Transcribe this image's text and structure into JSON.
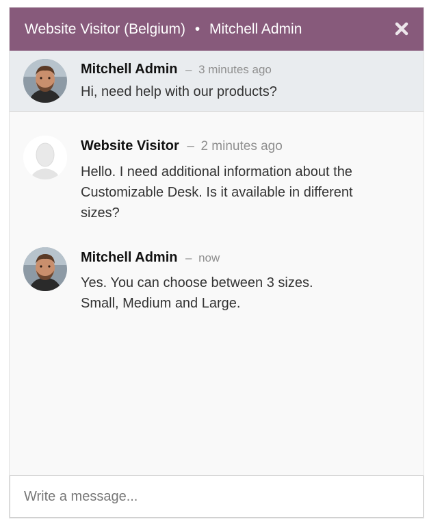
{
  "header": {
    "visitor": "Website Visitor (Belgium)",
    "separator": "•",
    "operator": "Mitchell Admin",
    "bg_color": "#875a7b",
    "close_icon": "close-icon"
  },
  "messages": [
    {
      "author": "Mitchell Admin",
      "separator": "–",
      "time": "3 minutes ago",
      "body": "Hi, need help with our products?",
      "avatar": "admin-avatar"
    },
    {
      "author": "Website Visitor",
      "separator": "–",
      "time": "2 minutes ago",
      "body": "Hello. I need additional information about the Customizable Desk. Is it available in different sizes?",
      "avatar": "visitor-avatar"
    },
    {
      "author": "Mitchell Admin",
      "separator": "–",
      "time": "now",
      "body": "Yes. You can choose between 3 sizes. Small, Medium and Large.",
      "avatar": "admin-avatar"
    }
  ],
  "composer": {
    "placeholder": "Write a message..."
  }
}
